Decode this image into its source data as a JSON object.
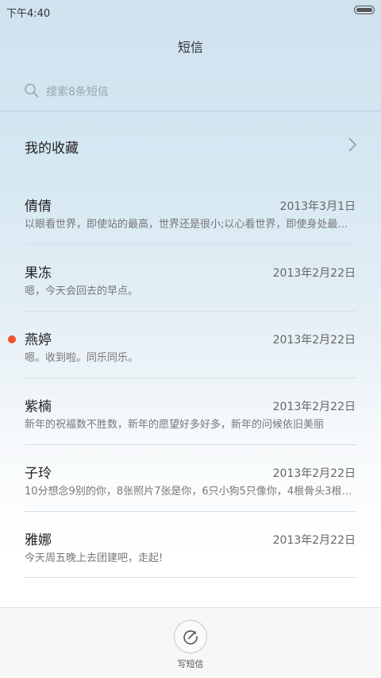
{
  "status_bar": {
    "time": "下午4:40",
    "battery_icon": "battery-icon"
  },
  "header": {
    "title": "短信"
  },
  "search": {
    "icon": "search-icon",
    "placeholder": "搜索8条短信"
  },
  "favorites": {
    "label": "我的收藏",
    "icon": "chevron-right-icon"
  },
  "conversations": [
    {
      "name": "倩倩",
      "date": "2013年3月1日",
      "preview": "以眼看世界，即使站的最高，世界还是很小;以心看世界，即使身处最低的地方，世界也是很大",
      "unread": false
    },
    {
      "name": "果冻",
      "date": "2013年2月22日",
      "preview": "嗯，今天会回去的早点。",
      "unread": false
    },
    {
      "name": "燕婷",
      "date": "2013年2月22日",
      "preview": "嗯。收到啦。同乐同乐。",
      "unread": true
    },
    {
      "name": "紫楠",
      "date": "2013年2月22日",
      "preview": "新年的祝福数不胜数，新年的愿望好多好多，新年的问候依旧美丽",
      "unread": false
    },
    {
      "name": "子玲",
      "date": "2013年2月22日",
      "preview": "10分想念9别的你，8张照片7张是你，6只小狗5只像你，4根骨头3根给你",
      "unread": false
    },
    {
      "name": "雅娜",
      "date": "2013年2月22日",
      "preview": "今天周五晚上去团建吧，走起!",
      "unread": false
    }
  ],
  "bottom_bar": {
    "compose_icon": "compose-icon",
    "compose_label": "写短信"
  },
  "colors": {
    "unread_dot": "#f0522b",
    "accent_text": "#222222"
  }
}
